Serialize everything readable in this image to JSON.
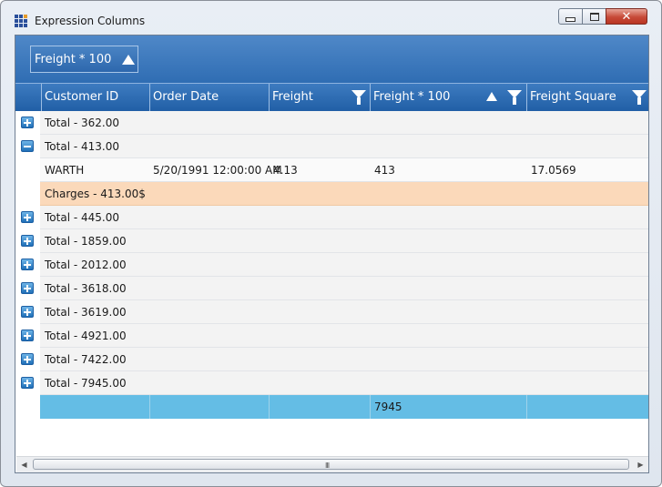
{
  "window": {
    "title": "Expression Columns",
    "close_glyph": "✕"
  },
  "group_panel": {
    "chip_label": "Freight * 100"
  },
  "columns": [
    {
      "label": "Customer ID"
    },
    {
      "label": "Order Date"
    },
    {
      "label": "Freight"
    },
    {
      "label": "Freight * 100"
    },
    {
      "label": "Freight Square"
    }
  ],
  "groups": [
    {
      "label": "Total - 362.00"
    },
    {
      "label": "Total - 413.00"
    },
    {
      "label": "Total - 445.00"
    },
    {
      "label": "Total - 1859.00"
    },
    {
      "label": "Total - 2012.00"
    },
    {
      "label": "Total - 3618.00"
    },
    {
      "label": "Total - 3619.00"
    },
    {
      "label": "Total - 4921.00"
    },
    {
      "label": "Total - 7422.00"
    },
    {
      "label": "Total - 7945.00"
    }
  ],
  "data_row": {
    "customer_id": "WARTH",
    "order_date": "5/20/1991 12:00:00 AM",
    "freight": "4.13",
    "freight_100": "413",
    "freight_square": "17.0569"
  },
  "group_summary": "Charges - 413.00$",
  "footer": {
    "freight_100": "7945"
  },
  "scrollbar": {
    "grip": "III"
  }
}
